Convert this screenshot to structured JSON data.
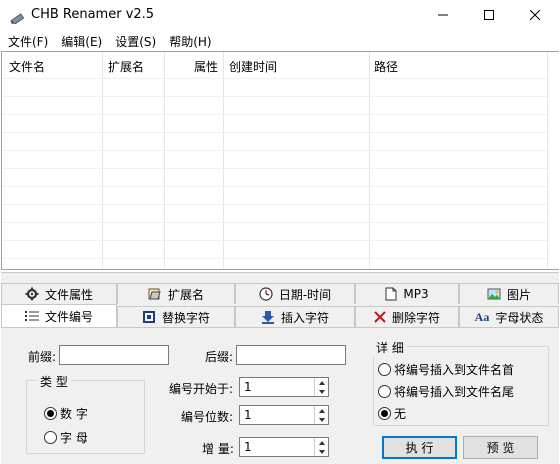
{
  "window": {
    "title": "CHB Renamer v2.5",
    "icons": {
      "app": "pencil-icon",
      "minimize": "minimize-icon",
      "maximize": "maximize-icon",
      "close": "close-icon"
    }
  },
  "menu": [
    "文件(F)",
    "编辑(E)",
    "设置(S)",
    "帮助(H)"
  ],
  "file_list": {
    "columns": [
      "文件名",
      "扩展名",
      "属性",
      "创建时间",
      "路径"
    ]
  },
  "tabs_row1": [
    {
      "label": "文件属性",
      "icon": "gear-icon"
    },
    {
      "label": "扩展名",
      "icon": "folder-icon"
    },
    {
      "label": "日期-时间",
      "icon": "clock-icon"
    },
    {
      "label": "MP3",
      "icon": "music-file-icon"
    },
    {
      "label": "图片",
      "icon": "picture-icon"
    }
  ],
  "tabs_row2": [
    {
      "label": "文件编号",
      "icon": "numbered-list-icon",
      "active": true
    },
    {
      "label": "替换字符",
      "icon": "replace-icon"
    },
    {
      "label": "插入字符",
      "icon": "insert-arrow-icon"
    },
    {
      "label": "删除字符",
      "icon": "delete-x-icon"
    },
    {
      "label": "字母状态",
      "icon": "letter-case-icon",
      "glyph": "Aa"
    }
  ],
  "numbering": {
    "prefix_label": "前缀:",
    "prefix_value": "",
    "suffix_label": "后缀:",
    "suffix_value": "",
    "type_group": "类 型",
    "type_options": [
      {
        "label": "数 字",
        "selected": true
      },
      {
        "label": "字 母",
        "selected": false
      }
    ],
    "start_label": "编号开始于:",
    "start_value": "1",
    "digits_label": "编号位数:",
    "digits_value": "1",
    "step_label": "增 量:",
    "step_value": "1",
    "detail_group": "详 细",
    "detail_options": [
      {
        "label": "将编号插入到文件名首",
        "selected": false
      },
      {
        "label": "将编号插入到文件名尾",
        "selected": false
      },
      {
        "label": "无",
        "selected": true
      }
    ],
    "execute_label": "执 行",
    "preview_label": "预 览"
  },
  "colors": {
    "accent": "#0078d7",
    "panel_bg": "#f0f0f0",
    "delete_icon": "#cc1111"
  }
}
